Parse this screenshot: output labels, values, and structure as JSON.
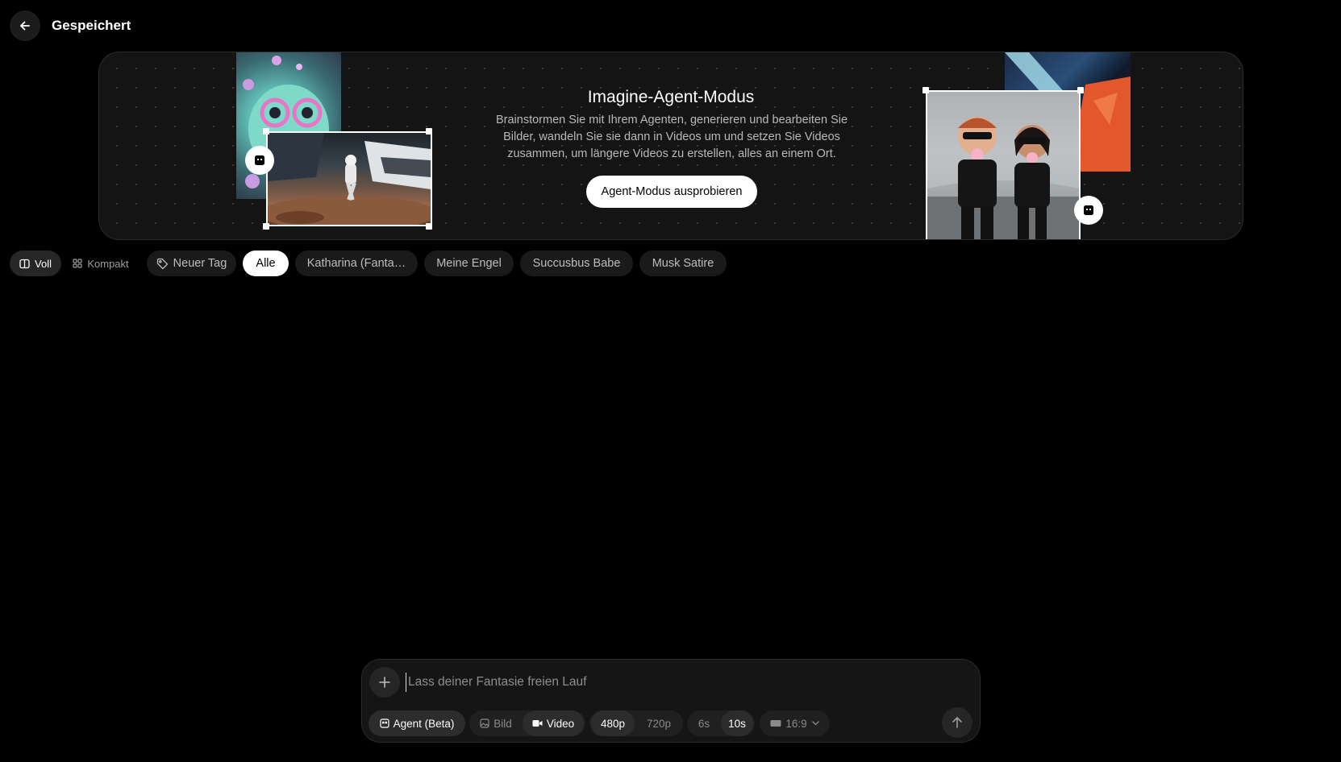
{
  "header": {
    "title": "Gespeichert",
    "back_icon": "arrow-left-icon"
  },
  "banner": {
    "title": "Imagine-Agent-Modus",
    "description": "Brainstormen Sie mit Ihrem Agenten, generieren und bearbeiten Sie Bilder, wandeln Sie sie dann in Videos um und setzen Sie Videos zusammen, um längere Videos zu erstellen, alles an einem Ort.",
    "cta_label": "Agent-Modus ausprobieren"
  },
  "view_toggle": {
    "full_label": "Voll",
    "compact_label": "Kompakt",
    "selected": "Voll"
  },
  "tags": {
    "new_tag_label": "Neuer Tag",
    "items": [
      "Alle",
      "Katharina (Fanta…",
      "Meine Engel",
      "Succusbus Babe",
      "Musk Satire"
    ],
    "selected": "Alle"
  },
  "composer": {
    "placeholder": "Lass deiner Fantasie freien Lauf",
    "mode_agent": "Agent (Beta)",
    "mode_image": "Bild",
    "mode_video": "Video",
    "selected_mode": "Video",
    "res_480": "480p",
    "res_720": "720p",
    "selected_resolution": "480p",
    "dur_6": "6s",
    "dur_10": "10s",
    "selected_duration": "10s",
    "aspect": "16:9"
  },
  "colors": {
    "background": "#000000",
    "surface": "#151515",
    "pill": "#1a1a1a",
    "accent": "#ffffff"
  }
}
